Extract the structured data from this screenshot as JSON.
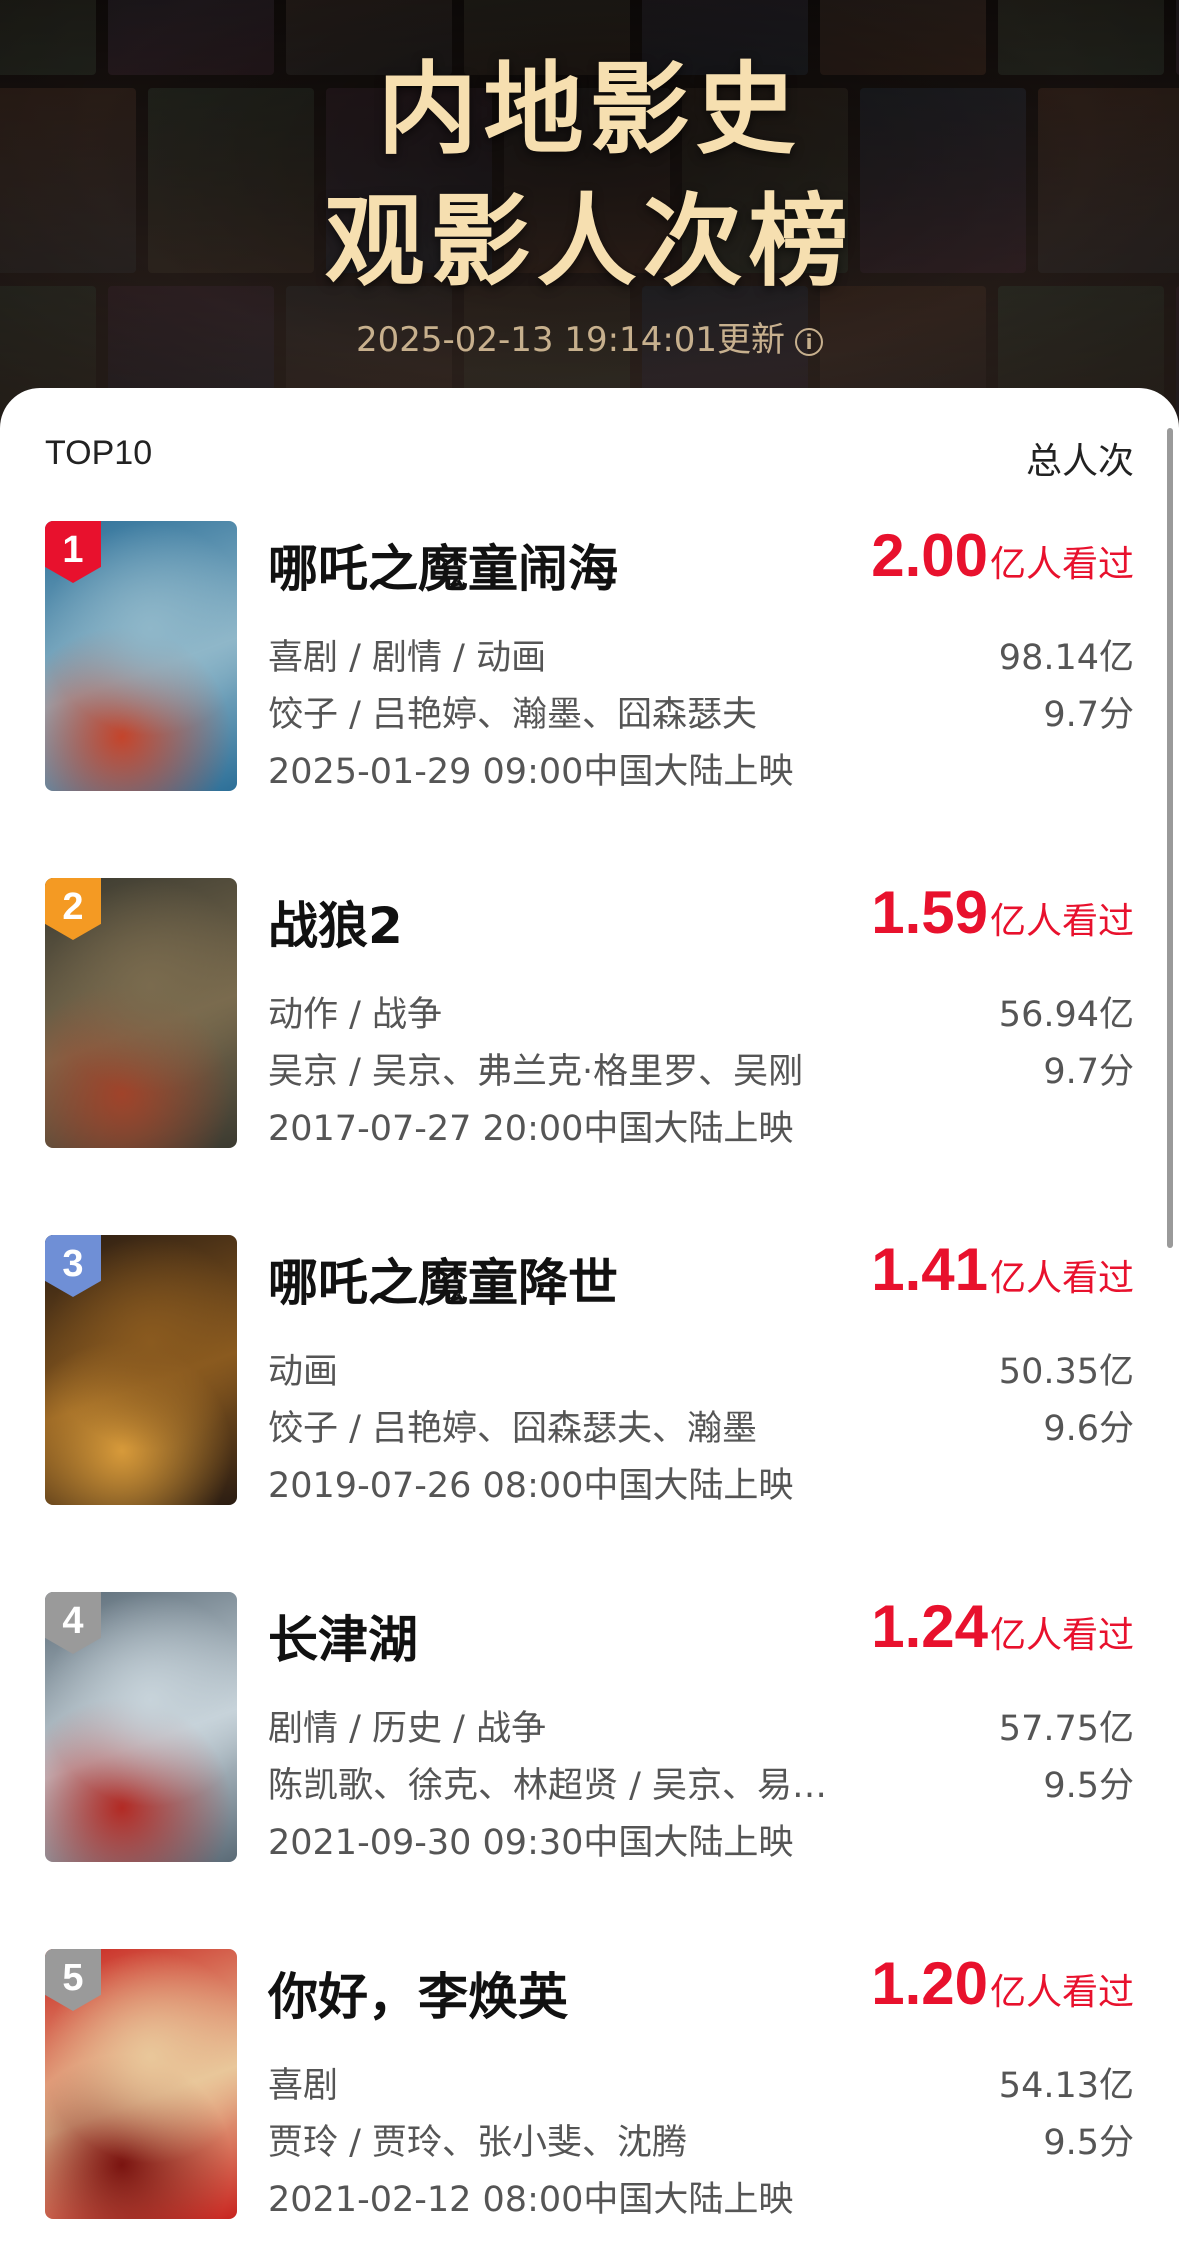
{
  "header": {
    "title_line1": "内地影史",
    "title_line2": "观影人次榜",
    "update_text": "2025-02-13 19:14:01更新",
    "info_glyph": "i"
  },
  "list": {
    "top_label": "TOP10",
    "total_label": "总人次",
    "count_unit": "亿人看过",
    "movies": [
      {
        "rank": "1",
        "title": "哪吒之魔童闹海",
        "count": "2.00",
        "genres": "喜剧 / 剧情 / 动画",
        "people": "饺子 / 吕艳婷、瀚墨、囧森瑟夫",
        "release": "2025-01-29 09:00中国大陆上映",
        "box_office": "98.14亿",
        "score": "9.7分",
        "badge_color": "#e8112d",
        "poster_colors": [
          "#2c6f98",
          "#8fb7c9",
          "#c4442b"
        ]
      },
      {
        "rank": "2",
        "title": "战狼2",
        "count": "1.59",
        "genres": "动作 / 战争",
        "people": "吴京 / 吴京、弗兰克·格里罗、吴刚",
        "release": "2017-07-27 20:00中国大陆上映",
        "box_office": "56.94亿",
        "score": "9.7分",
        "badge_color": "#f49a23",
        "poster_colors": [
          "#3b3a30",
          "#7a6b4e",
          "#a0432a"
        ]
      },
      {
        "rank": "3",
        "title": "哪吒之魔童降世",
        "count": "1.41",
        "genres": "动画",
        "people": "饺子 / 吕艳婷、囧森瑟夫、瀚墨",
        "release": "2019-07-26 08:00中国大陆上映",
        "box_office": "50.35亿",
        "score": "9.6分",
        "badge_color": "#6f8fd6",
        "poster_colors": [
          "#2a1c12",
          "#8a5a1f",
          "#d79a3a"
        ]
      },
      {
        "rank": "4",
        "title": "长津湖",
        "count": "1.24",
        "genres": "剧情 / 历史 / 战争",
        "people": "陈凯歌、徐克、林超贤 / 吴京、易…",
        "release": "2021-09-30 09:30中国大陆上映",
        "box_office": "57.75亿",
        "score": "9.5分",
        "badge_color": "#9a9a9a",
        "poster_colors": [
          "#5a6a76",
          "#c7d3da",
          "#b22a24"
        ]
      },
      {
        "rank": "5",
        "title": "你好，李焕英",
        "count": "1.20",
        "genres": "喜剧",
        "people": "贾玲 / 贾玲、张小斐、沈腾",
        "release": "2021-02-12 08:00中国大陆上映",
        "box_office": "54.13亿",
        "score": "9.5分",
        "badge_color": "#9a9a9a",
        "poster_colors": [
          "#c8241f",
          "#e9c79a",
          "#7a1410"
        ]
      }
    ]
  }
}
